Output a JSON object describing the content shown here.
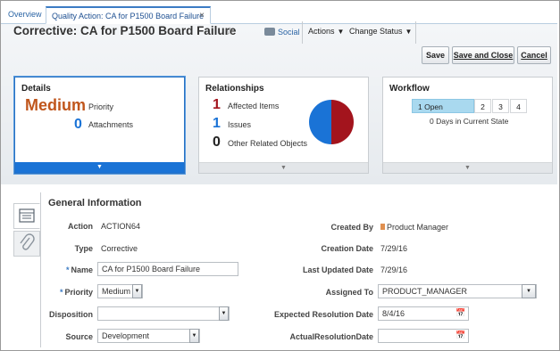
{
  "tabs": [
    {
      "label": "Overview"
    },
    {
      "label": "Quality Action: CA for P1500 Board Failure",
      "close": "×"
    }
  ],
  "header": {
    "title": "Corrective: CA for P1500 Board Failure",
    "star": "☆",
    "social": "Social",
    "actions": "Actions",
    "change_status": "Change Status",
    "caret": "▼",
    "save": "Save",
    "save_close": "Save and Close",
    "cancel": "Cancel"
  },
  "details": {
    "title": "Details",
    "priority_value": "Medium",
    "priority_label": "Priority",
    "attachments_value": "0",
    "attachments_label": "Attachments",
    "expand": "▼",
    "priority_color": "#c0561c",
    "count_color": "#1a73d6"
  },
  "relationships": {
    "title": "Relationships",
    "rows": [
      {
        "count": "1",
        "label": "Affected Items",
        "color": "#a3141d"
      },
      {
        "count": "1",
        "label": "Issues",
        "color": "#1a73d6"
      },
      {
        "count": "0",
        "label": "Other Related Objects",
        "color": "#222222"
      }
    ],
    "expand": "▼",
    "pie_colors": [
      "#a3141d",
      "#1a73d6"
    ]
  },
  "workflow": {
    "title": "Workflow",
    "states": [
      "1 Open",
      "2",
      "3",
      "4"
    ],
    "status_text": "0 Days in Current State",
    "expand": "▼",
    "active_color": "#a9d9ef"
  },
  "general": {
    "title": "General Information",
    "left": {
      "action_label": "Action",
      "action_value": "ACTION64",
      "type_label": "Type",
      "type_value": "Corrective",
      "name_label": "Name",
      "name_value": "CA for P1500 Board Failure",
      "priority_label": "Priority",
      "priority_value": "Medium",
      "disposition_label": "Disposition",
      "disposition_value": "",
      "source_label": "Source",
      "source_value": "Development"
    },
    "right": {
      "created_by_label": "Created By",
      "created_by_value": "Product Manager",
      "creation_date_label": "Creation Date",
      "creation_date_value": "7/29/16",
      "last_updated_label": "Last Updated Date",
      "last_updated_value": "7/29/16",
      "assigned_to_label": "Assigned To",
      "assigned_to_value": "PRODUCT_MANAGER",
      "expected_label": "Expected Resolution Date",
      "expected_value": "8/4/16",
      "actual_label": "ActualResolutionDate",
      "actual_value": ""
    },
    "required_mark": "*",
    "dropdown_glyph": "▼",
    "calendar_icon": "calendar-icon"
  }
}
